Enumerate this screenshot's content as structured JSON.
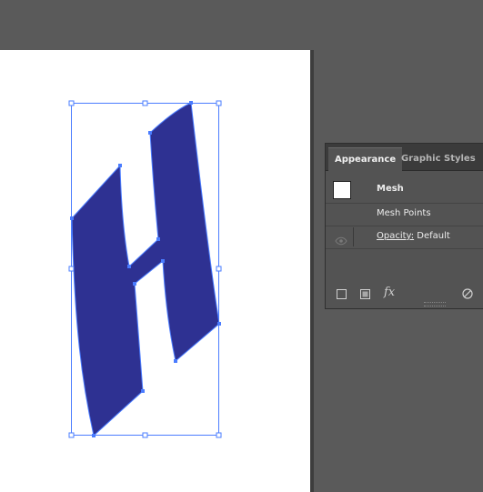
{
  "appearance_panel": {
    "tabs": [
      {
        "label": "Appearance",
        "active": true
      },
      {
        "label": "Graphic Styles",
        "active": false
      }
    ],
    "object_type": "Mesh",
    "rows": [
      {
        "label": "Mesh Points"
      },
      {
        "label": "Opacity:",
        "value": "Default"
      }
    ],
    "footer_icons": [
      "new-stroke-icon",
      "new-fill-icon",
      "fx-icon",
      "clear-appearance-icon"
    ]
  },
  "colors": {
    "shape_fill": "#2e3192",
    "selection": "#4a7cff",
    "workspace": "#5a5a5a",
    "artboard": "#ffffff"
  }
}
